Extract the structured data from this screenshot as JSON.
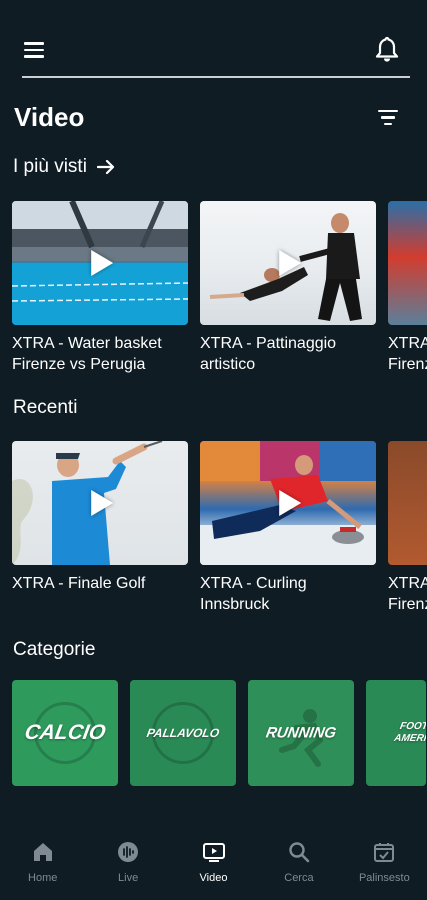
{
  "header": {
    "menu_icon": "hamburger-menu-icon",
    "bell_icon": "bell-icon"
  },
  "page": {
    "title": "Video",
    "filter_icon": "filter-icon"
  },
  "sections": {
    "most_viewed": {
      "title": "I più visti",
      "arrow_icon": "arrow-right-icon",
      "items": [
        {
          "title": "XTRA - Water basket\nFirenze vs Perugia"
        },
        {
          "title": "XTRA - Pattinaggio\nartistico"
        },
        {
          "title": "XTRA -\nFirenz"
        }
      ]
    },
    "recent": {
      "title": "Recenti",
      "items": [
        {
          "title": "XTRA - Finale Golf"
        },
        {
          "title": "XTRA - Curling\nInnsbruck"
        },
        {
          "title": "XTRA -\nFirenz"
        }
      ]
    },
    "categories": {
      "title": "Categorie",
      "items": [
        {
          "label": "CALCIO",
          "color": "#2e9a5c"
        },
        {
          "label": "PALLAVOLO",
          "color": "#2a8a56"
        },
        {
          "label": "RUNNING",
          "color": "#2f8f58"
        },
        {
          "label": "FOOTBALL AMERICANO",
          "color": "#2a8a56"
        }
      ]
    }
  },
  "bottom_nav": [
    {
      "label": "Home",
      "icon": "home-icon",
      "active": false
    },
    {
      "label": "Live",
      "icon": "live-icon",
      "active": false
    },
    {
      "label": "Video",
      "icon": "video-icon",
      "active": true
    },
    {
      "label": "Cerca",
      "icon": "search-icon",
      "active": false
    },
    {
      "label": "Palinsesto",
      "icon": "calendar-check-icon",
      "active": false
    }
  ],
  "colors": {
    "background": "#0f1c24",
    "nav_inactive": "#7f8a91",
    "nav_active": "#ffffff"
  }
}
